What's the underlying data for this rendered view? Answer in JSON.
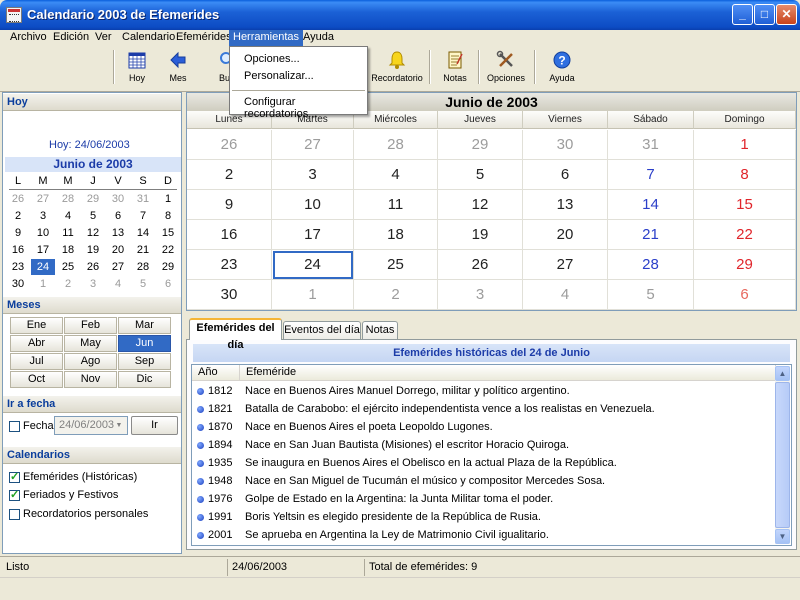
{
  "window": {
    "title": "Calendario 2003 de Efemerides"
  },
  "menubar": [
    {
      "label": "Archivo",
      "name": "menu-archivo"
    },
    {
      "label": "Edición",
      "name": "menu-edicion"
    },
    {
      "label": "Ver",
      "name": "menu-ver"
    },
    {
      "label": "Calendario",
      "name": "menu-calendario"
    },
    {
      "label": "Efemérides",
      "name": "menu-efemerides"
    },
    {
      "label": "Herramientas",
      "name": "menu-herramientas"
    },
    {
      "label": "Ayuda",
      "name": "menu-ayuda"
    }
  ],
  "toolbar": {
    "hoy": "Hoy",
    "mes": "Mes",
    "buscar_partial": "Bu",
    "recordatorio": "Recordatorio",
    "notas": "Notas",
    "opciones": "Opciones",
    "ayuda": "Ayuda",
    "icons": {
      "hoy": "calendar-grid-icon",
      "mes": "back-arrow-icon",
      "buscar": "search-icon",
      "recordatorio": "bell-icon",
      "notas": "notepad-icon",
      "opciones": "tools-icon",
      "ayuda": "help-icon"
    }
  },
  "dropdown": {
    "opciones": "Opciones...",
    "personalizar": "Personalizar...",
    "configurar": "Configurar recordatorios..."
  },
  "left": {
    "hoy_header": "Hoy",
    "today_text": "Hoy: 24/06/2003",
    "mini_title": "Junio de 2003",
    "dow": [
      "L",
      "M",
      "M",
      "J",
      "V",
      "S",
      "D"
    ],
    "weeks": [
      [
        "26",
        "27",
        "28",
        "29",
        "30",
        "31",
        "1"
      ],
      [
        "2",
        "3",
        "4",
        "5",
        "6",
        "7",
        "8"
      ],
      [
        "9",
        "10",
        "11",
        "12",
        "13",
        "14",
        "15"
      ],
      [
        "16",
        "17",
        "18",
        "19",
        "20",
        "21",
        "22"
      ],
      [
        "23",
        "24",
        "25",
        "26",
        "27",
        "28",
        "29"
      ],
      [
        "30",
        "1",
        "2",
        "3",
        "4",
        "5",
        "6"
      ]
    ],
    "meses_header": "Meses",
    "months": [
      "Ene",
      "Feb",
      "Mar",
      "Abr",
      "May",
      "Jun",
      "Jul",
      "Ago",
      "Sep",
      "Oct",
      "Nov",
      "Dic"
    ],
    "selected_month": "Jun",
    "ir_header": "Ir a fecha",
    "fecha_label": "Fecha:",
    "fecha_value": "24/06/2003",
    "ir_button": "Ir",
    "calendarios_header": "Calendarios",
    "cal_efemerides": "Efemérides (Históricas)",
    "cal_feriados": "Feriados y Festivos",
    "cal_recordatorios": "Recordatorios personales",
    "cal_checked": [
      true,
      true,
      false
    ]
  },
  "calendar": {
    "title": "Junio de 2003",
    "days": [
      "Lunes",
      "Martes",
      "Miércoles",
      "Jueves",
      "Viernes",
      "Sábado",
      "Domingo"
    ],
    "weeks": [
      [
        "26",
        "27",
        "28",
        "29",
        "30",
        "31",
        "1"
      ],
      [
        "2",
        "3",
        "4",
        "5",
        "6",
        "7",
        "8"
      ],
      [
        "9",
        "10",
        "11",
        "12",
        "13",
        "14",
        "15"
      ],
      [
        "16",
        "17",
        "18",
        "19",
        "20",
        "21",
        "22"
      ],
      [
        "23",
        "24",
        "25",
        "26",
        "27",
        "28",
        "29"
      ],
      [
        "30",
        "1",
        "2",
        "3",
        "4",
        "5",
        "6"
      ]
    ],
    "selected_day": "24"
  },
  "tabs": [
    "Efemérides del día",
    "Eventos del día",
    "Notas"
  ],
  "list": {
    "title": "Efemérides históricas del 24 de Junio",
    "col_year": "Año",
    "col_event": "Efeméride",
    "rows": [
      {
        "year": "1812",
        "text": "Nace en Buenos Aires Manuel Dorrego, militar y político argentino."
      },
      {
        "year": "1821",
        "text": "Batalla de Carabobo: el ejército independentista vence a los realistas en Venezuela."
      },
      {
        "year": "1870",
        "text": "Nace en Buenos Aires el poeta Leopoldo Lugones."
      },
      {
        "year": "1894",
        "text": "Nace en San Juan Bautista (Misiones) el escritor Horacio Quiroga."
      },
      {
        "year": "1935",
        "text": "Se inaugura en Buenos Aires el Obelisco en la actual Plaza de la República."
      },
      {
        "year": "1948",
        "text": "Nace en San Miguel de Tucumán el músico y compositor Mercedes Sosa."
      },
      {
        "year": "1976",
        "text": "Golpe de Estado en la Argentina: la Junta Militar toma el poder."
      },
      {
        "year": "1991",
        "text": "Boris Yeltsin es elegido presidente de la República de Rusia."
      },
      {
        "year": "2001",
        "text": "Se aprueba en Argentina la Ley de Matrimonio Civil igualitario."
      }
    ]
  },
  "status": {
    "left": "Listo",
    "date": "24/06/2003",
    "total": "Total de efemérides: 9"
  },
  "colors": {
    "accent": "#316ac5",
    "saturday": "#2b3fc9",
    "sunday": "#e0252b"
  }
}
